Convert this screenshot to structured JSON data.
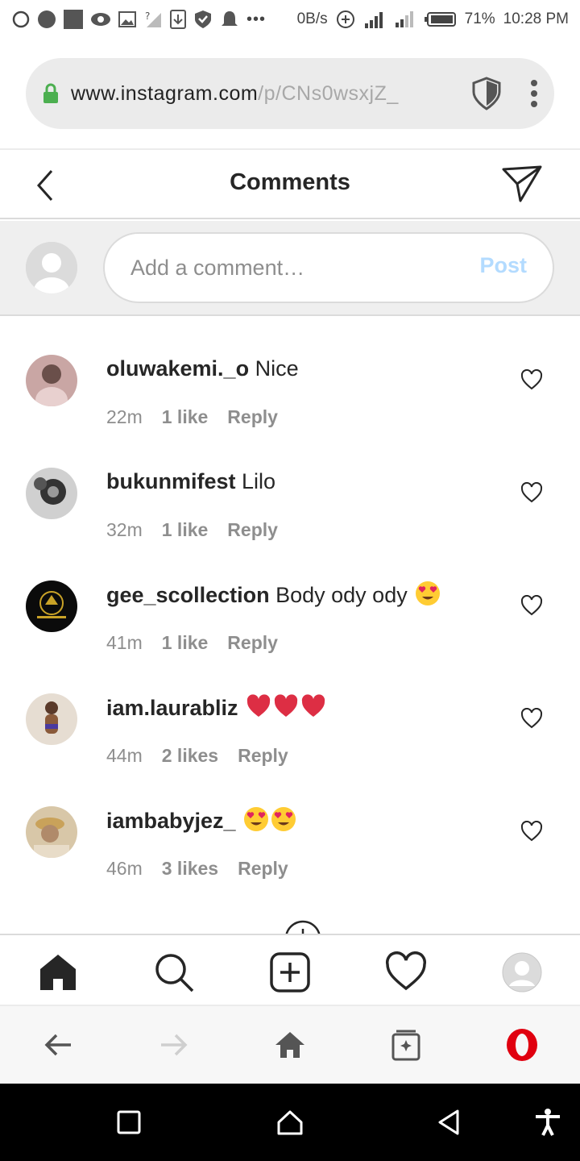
{
  "status_bar": {
    "net_speed": "0B/s",
    "battery": "71%",
    "time": "10:28 PM"
  },
  "browser": {
    "url_host": "www.instagram.com",
    "url_path": "/p/CNs0wsxjZ_"
  },
  "header": {
    "title": "Comments"
  },
  "composer": {
    "placeholder": "Add a comment…",
    "post_label": "Post"
  },
  "comments": [
    {
      "username": "oluwakemi._o",
      "text": "Nice",
      "emojis": [],
      "time": "22m",
      "likes": "1 like",
      "reply": "Reply",
      "avatar_color": "#b58a86"
    },
    {
      "username": "bukunmifest",
      "text": "Lilo",
      "emojis": [],
      "time": "32m",
      "likes": "1 like",
      "reply": "Reply",
      "avatar_color": "#5a5a5a"
    },
    {
      "username": "gee_scollection",
      "text": "Body ody ody",
      "emojis": [
        "heart-eyes"
      ],
      "time": "41m",
      "likes": "1 like",
      "reply": "Reply",
      "avatar_color": "#0b0b0b"
    },
    {
      "username": "iam.laurabliz",
      "text": "",
      "emojis": [
        "red-heart",
        "red-heart",
        "red-heart"
      ],
      "time": "44m",
      "likes": "2 likes",
      "reply": "Reply",
      "avatar_color": "#c7b6a2"
    },
    {
      "username": "iambabyjez_",
      "text": "",
      "emojis": [
        "heart-eyes",
        "heart-eyes"
      ],
      "time": "46m",
      "likes": "3 likes",
      "reply": "Reply",
      "avatar_color": "#d8c7a8"
    }
  ],
  "colors": {
    "post_disabled": "#b3dbff",
    "opera_red": "#e0000f",
    "secure_lock": "#4caf50"
  }
}
